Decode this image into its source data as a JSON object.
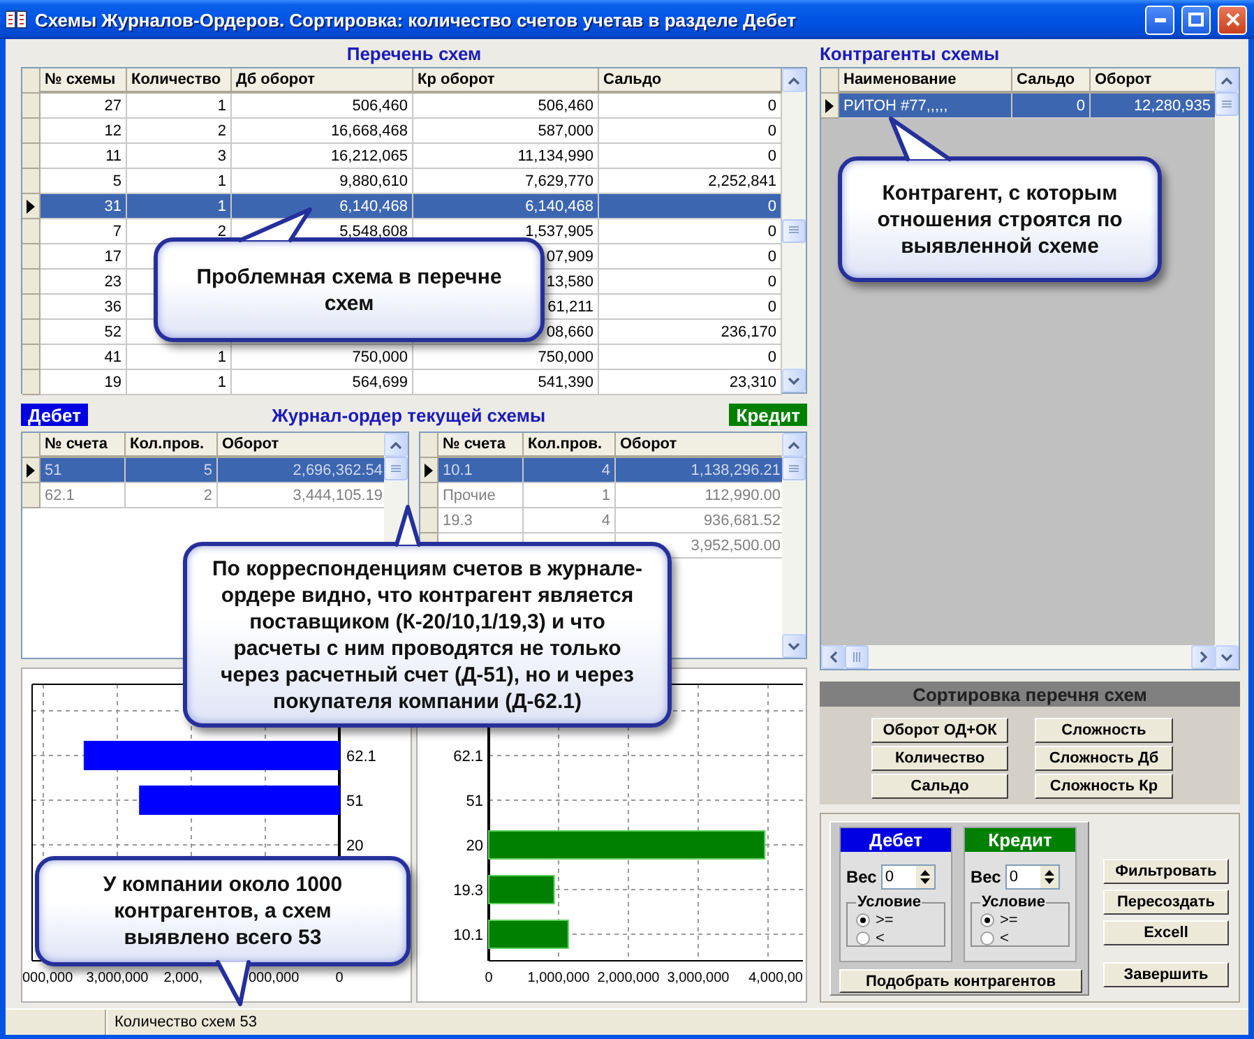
{
  "window": {
    "title": "Схемы Журналов-Ордеров.  Сортировка: количество счетов учетав в разделе Дебет"
  },
  "schemes": {
    "title": "Перечень схем",
    "columns": [
      "№ схемы",
      "Количество",
      "Дб оборот",
      "Кр оборот",
      "Сальдо"
    ],
    "rows": [
      {
        "cells": [
          "27",
          "1",
          "506,460",
          "506,460",
          "0"
        ],
        "selected": false
      },
      {
        "cells": [
          "12",
          "2",
          "16,668,468",
          "587,000",
          "0"
        ],
        "selected": false
      },
      {
        "cells": [
          "11",
          "3",
          "16,212,065",
          "11,134,990",
          "0"
        ],
        "selected": false
      },
      {
        "cells": [
          "5",
          "1",
          "9,880,610",
          "7,629,770",
          "2,252,841"
        ],
        "selected": false
      },
      {
        "cells": [
          "31",
          "1",
          "6,140,468",
          "6,140,468",
          "0"
        ],
        "selected": true
      },
      {
        "cells": [
          "7",
          "2",
          "5,548,608",
          "1,537,905",
          "0"
        ],
        "selected": false
      },
      {
        "cells": [
          "17",
          null,
          null,
          "07,909",
          "0"
        ],
        "selected": false
      },
      {
        "cells": [
          "23",
          null,
          null,
          "13,580",
          "0"
        ],
        "selected": false
      },
      {
        "cells": [
          "36",
          null,
          null,
          "61,211",
          "0"
        ],
        "selected": false
      },
      {
        "cells": [
          "52",
          null,
          null,
          "08,660",
          "236,170"
        ],
        "selected": false
      },
      {
        "cells": [
          "41",
          "1",
          "750,000",
          "750,000",
          "0"
        ],
        "selected": false
      },
      {
        "cells": [
          "19",
          "1",
          "564,699",
          "541,390",
          "23,310"
        ],
        "selected": false
      }
    ]
  },
  "journal": {
    "title": "Журнал-ордер текущей схемы",
    "debit": {
      "label": "Дебет",
      "columns": [
        "№ счета",
        "Кол.пров.",
        "Оборот"
      ],
      "rows": [
        {
          "cells": [
            "51",
            "5",
            "2,696,362.54"
          ],
          "selected": true
        },
        {
          "cells": [
            "62.1",
            "2",
            "3,444,105.19"
          ],
          "selected": false
        }
      ],
      "chart_data": {
        "type": "bar",
        "orientation": "horizontal",
        "categories": [
          "62.1",
          "51",
          "20"
        ],
        "series": [
          {
            "color": "#0000ff",
            "values": [
              3444105.19,
              2696362.54,
              null
            ]
          }
        ],
        "xlim": [
          4000000,
          0
        ],
        "xticks": [
          {
            "value": 3000000,
            "label": "3,000,000"
          },
          0
        ],
        "grid": true
      },
      "cut_tick_labels": [
        "000,000",
        "2,000,",
        "000,000"
      ]
    },
    "credit": {
      "label": "Кредит",
      "columns": [
        "№ счета",
        "Кол.пров.",
        "Оборот"
      ],
      "rows": [
        {
          "cells": [
            "10.1",
            "4",
            "1,138,296.21"
          ],
          "selected": true
        },
        {
          "cells": [
            "Прочие",
            "1",
            "112,990.00"
          ],
          "selected": false
        },
        {
          "cells": [
            "19.3",
            "4",
            "936,681.52"
          ],
          "selected": false
        },
        {
          "cells": [
            null,
            null,
            "3,952,500.00"
          ],
          "selected": false
        }
      ],
      "chart_data": {
        "type": "bar",
        "orientation": "horizontal",
        "categories": [
          "62.1",
          "51",
          "20",
          "19.3",
          "10.1"
        ],
        "series": [
          {
            "color": "#008000",
            "values": [
              null,
              null,
              3952500,
              936681.52,
              1138296.21
            ]
          }
        ],
        "xlim": [
          0,
          4000000
        ],
        "xticks": [
          0,
          {
            "value": 1000000,
            "label": "1,000,000"
          },
          {
            "value": 2000000,
            "label": "2,000,000"
          },
          {
            "value": 3000000,
            "label": "3,000,000"
          }
        ],
        "grid": true
      },
      "cut_tick_labels": [
        "4,000,00"
      ]
    }
  },
  "counterparties": {
    "title": "Контрагенты схемы",
    "columns": [
      "Наименование",
      "Сальдо",
      "Оборот"
    ],
    "rows": [
      {
        "cells": [
          "РИТОН #77,,,,,",
          "0",
          "12,280,935"
        ],
        "selected": true
      }
    ]
  },
  "sorting": {
    "title": "Сортировка перечня схем",
    "buttons": [
      "Оборот ОД+ОК",
      "Сложность",
      "Количество",
      "Сложность Дб",
      "Сальдо",
      "Сложность Кр"
    ]
  },
  "filter": {
    "debit": {
      "label": "Дебет",
      "weight_label": "Вес",
      "weight": "0",
      "condition_label": "Условие",
      "options": [
        {
          "label": ">=",
          "selected": true
        },
        {
          "label": "<",
          "selected": false
        }
      ]
    },
    "credit": {
      "label": "Кредит",
      "weight_label": "Вес",
      "weight": "0",
      "condition_label": "Условие",
      "options": [
        {
          "label": ">=",
          "selected": true
        },
        {
          "label": "<",
          "selected": false
        }
      ]
    },
    "pick_button": "Подобрать контрагентов",
    "buttons": [
      "Фильтровать",
      "Пересоздать",
      "Excell",
      "Завершить"
    ]
  },
  "status_bar": {
    "text": "Количество схем 53"
  },
  "callouts": [
    {
      "text": "Проблемная схема в перечне схем"
    },
    {
      "text": "По корреспонденциям счетов в журнале-ордере видно, что контрагент является поставщиком (К-20/10,1/19,3) и что расчеты с ним проводятся не только через расчетный счет (Д-51), но и через покупателя компании (Д-62.1)"
    },
    {
      "text": "Контрагент, с которым отношения строятся по выявленной схеме"
    },
    {
      "text": "У компании около 1000 контрагентов, а схем выявлено всего 53"
    }
  ]
}
